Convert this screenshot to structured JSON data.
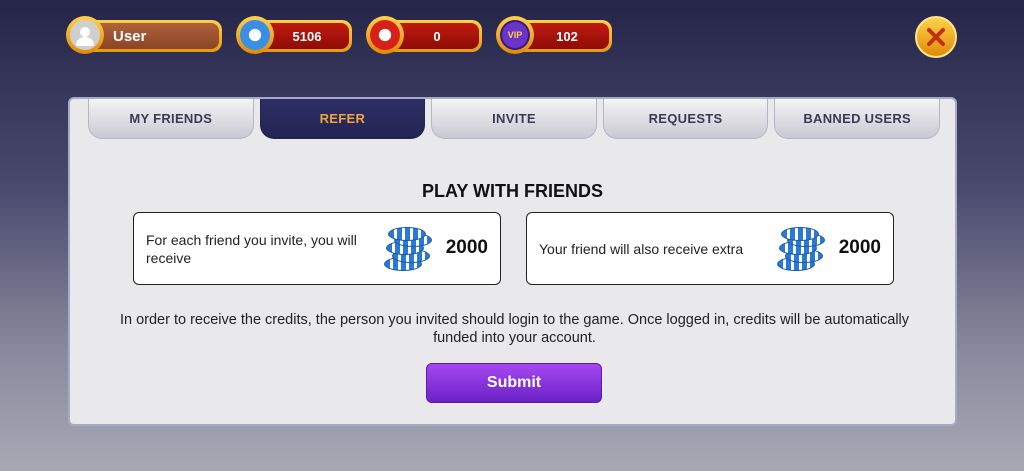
{
  "header": {
    "username": "User",
    "chips_balance": "5106",
    "poker_chips": "0",
    "vip_points": "102",
    "vip_label": "VIP"
  },
  "tabs": [
    {
      "label": "MY FRIENDS",
      "active": false
    },
    {
      "label": "REFER",
      "active": true
    },
    {
      "label": "INVITE",
      "active": false
    },
    {
      "label": "REQUESTS",
      "active": false
    },
    {
      "label": "BANNED USERS",
      "active": false
    }
  ],
  "refer": {
    "heading": "PLAY WITH FRIENDS",
    "card1_text": "For each friend you invite, you will receive",
    "card1_value": "2000",
    "card2_text": "Your friend will also receive extra",
    "card2_value": "2000",
    "info": "In order to receive the credits, the person you invited should login to the game. Once logged in, credits will be automatically funded into your account.",
    "submit_label": "Submit"
  },
  "colors": {
    "active_tab_bg": "#2d2f66",
    "active_tab_text": "#f2a53a",
    "submit_bg": "#8a34dc",
    "gold": "#f0b020"
  }
}
